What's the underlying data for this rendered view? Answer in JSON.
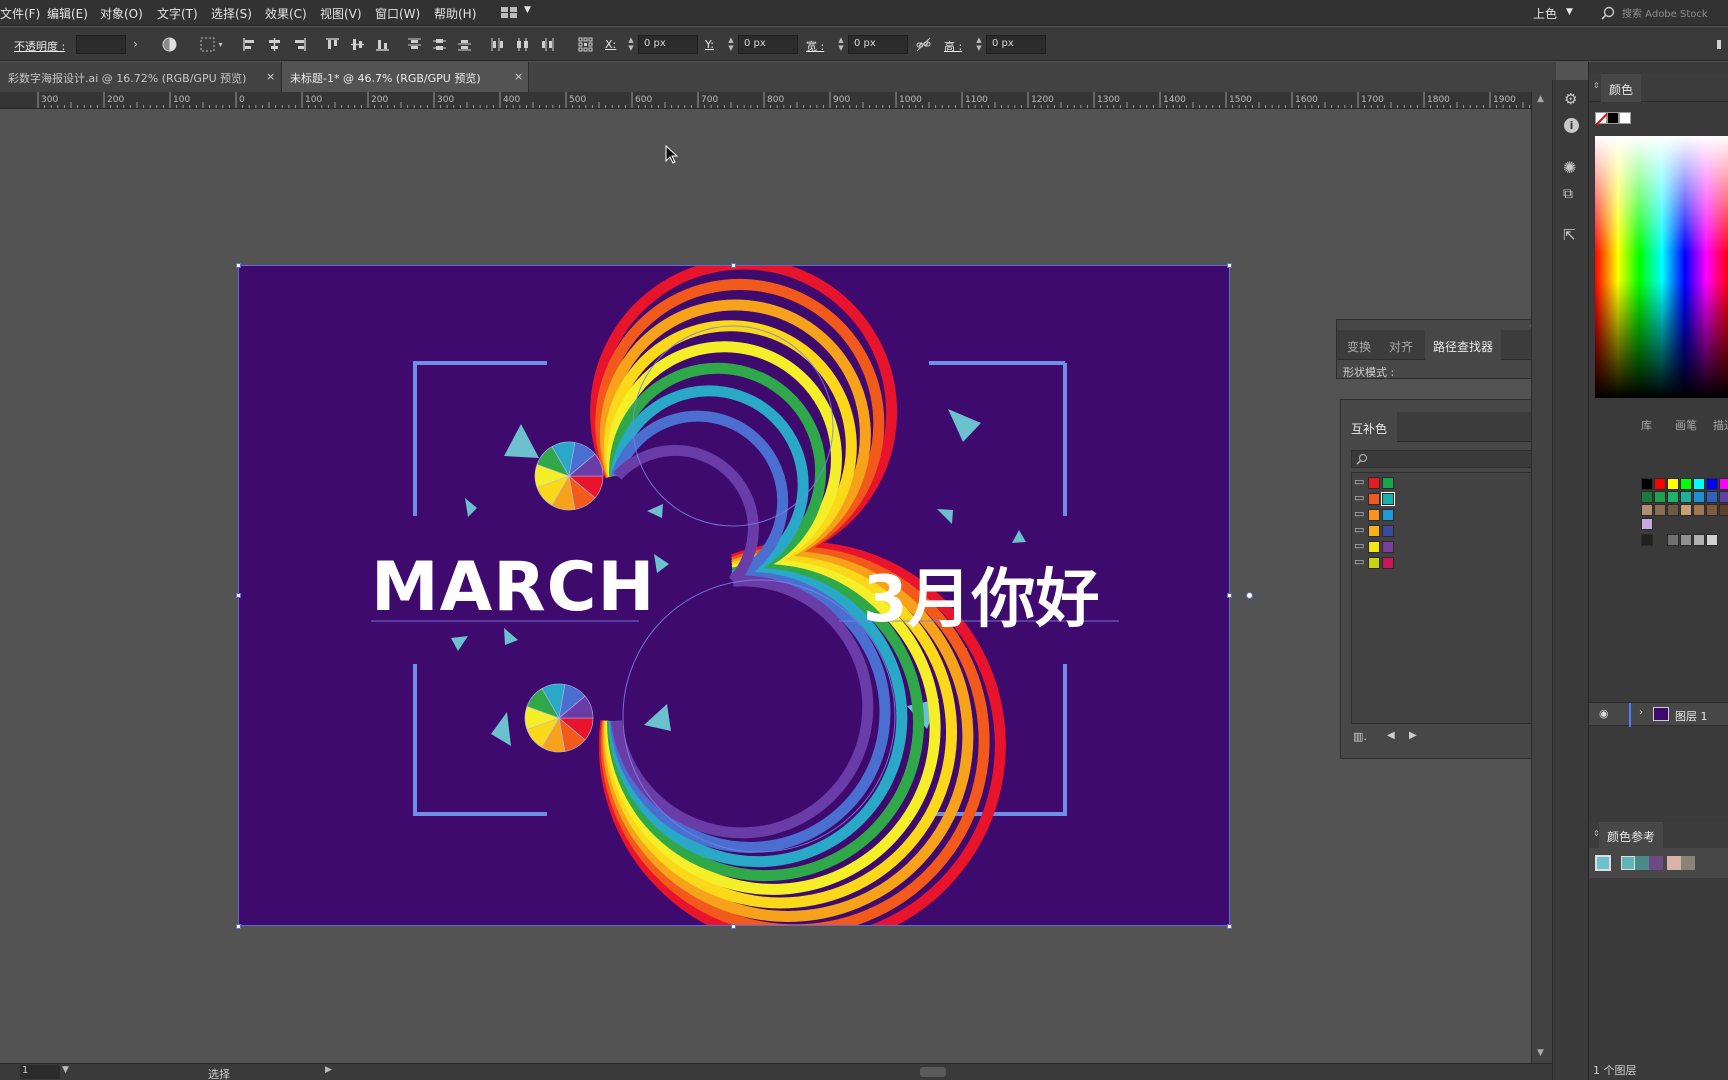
{
  "menu": [
    "文件(F)",
    "编辑(E)",
    "对象(O)",
    "文字(T)",
    "选择(S)",
    "效果(C)",
    "视图(V)",
    "窗口(W)",
    "帮助(H)"
  ],
  "workspace": "上色",
  "stock_search_placeholder": "搜索 Adobe Stock",
  "control": {
    "opacity_label": "不透明度 :",
    "x_label": "X:",
    "x_value": "0 px",
    "y_label": "Y:",
    "y_value": "0 px",
    "w_label": "宽 :",
    "w_value": "0 px",
    "h_label": "高 :",
    "h_value": "0 px"
  },
  "tabs": [
    {
      "label": "彩数字海报设计.ai @ 16.72% (RGB/GPU 预览)",
      "active": false
    },
    {
      "label": "未标题-1* @ 46.7% (RGB/GPU 预览)",
      "active": true
    }
  ],
  "ruler_labels": [
    "300",
    "200",
    "100",
    "0",
    "100",
    "200",
    "300",
    "400",
    "500",
    "600",
    "700",
    "800",
    "900",
    "1000",
    "1100",
    "1200",
    "1300",
    "1400",
    "1500",
    "1600",
    "1700",
    "1800",
    "1900"
  ],
  "artwork": {
    "left_text": "MARCH",
    "right_text": "3月你好",
    "background_color": "#3e0a6e",
    "rainbow_colors": [
      "#e8142b",
      "#f25a1b",
      "#f7a21b",
      "#fbd81a",
      "#f5ef2a",
      "#2fa84a",
      "#2aa8c8",
      "#4a6fd0",
      "#6a3ca8"
    ]
  },
  "panels": {
    "color": {
      "title": "颜色"
    },
    "pathfinder": {
      "tabs": [
        "变换",
        "对齐",
        "路径查找器"
      ],
      "shape_modes_label": "形状模式 :"
    },
    "harmony": {
      "title": "互补色",
      "side_tabs": [
        "库",
        "画笔",
        "描边"
      ]
    },
    "layers": {
      "layer_name": "图层 1",
      "footer": "1 个图层"
    },
    "color_guide": {
      "title": "颜色参考"
    }
  },
  "harmony_groups": [
    [
      "#e41c23",
      "#1aa64a"
    ],
    [
      "#f05a22",
      "#18b2a8"
    ],
    [
      "#f7941d",
      "#1e9ad6"
    ],
    [
      "#f6b21a",
      "#3d4aa0"
    ],
    [
      "#f4e41a",
      "#7a3e9a"
    ],
    [
      "#c8d41a",
      "#c8185a"
    ]
  ],
  "status": {
    "zoom_value": "1",
    "tool_label": "选择"
  }
}
